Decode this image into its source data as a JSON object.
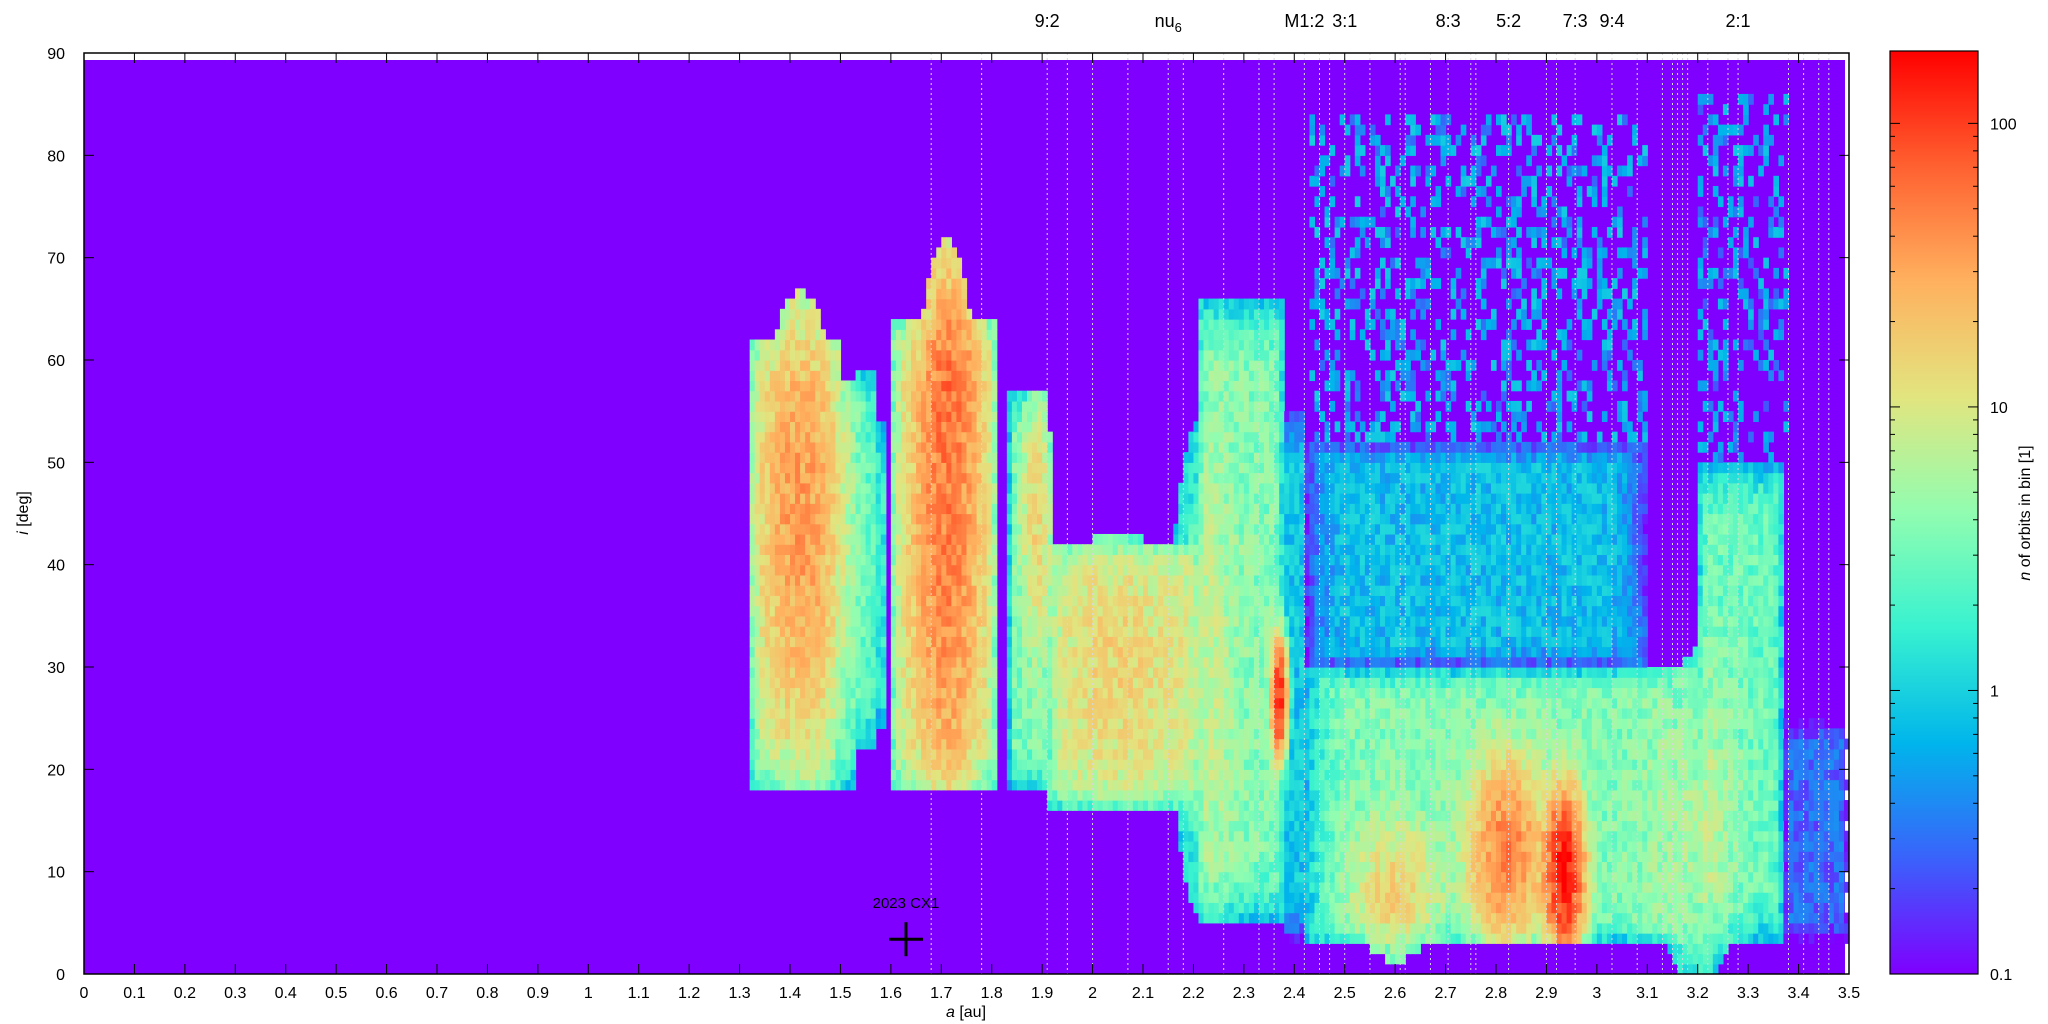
{
  "chart_data": {
    "type": "heatmap",
    "title": "",
    "xlabel_prefix": "a",
    "xlabel_suffix": " [au]",
    "ylabel_prefix": "i",
    "ylabel_suffix": " [deg]",
    "xlim": [
      0,
      3.5
    ],
    "ylim": [
      0,
      90
    ],
    "x_ticks": [
      "0",
      "0.1",
      "0.2",
      "0.3",
      "0.4",
      "0.5",
      "0.6",
      "0.7",
      "0.8",
      "0.9",
      "1",
      "1.1",
      "1.2",
      "1.3",
      "1.4",
      "1.5",
      "1.6",
      "1.7",
      "1.8",
      "1.9",
      "2",
      "2.1",
      "2.2",
      "2.3",
      "2.4",
      "2.5",
      "2.6",
      "2.7",
      "2.8",
      "2.9",
      "3",
      "3.1",
      "3.2",
      "3.3",
      "3.4",
      "3.5"
    ],
    "y_ticks": [
      "0",
      "10",
      "20",
      "30",
      "40",
      "50",
      "60",
      "70",
      "80",
      "90"
    ],
    "colorbar": {
      "label_prefix": "n",
      "label_suffix": " of orbits in bin [1]",
      "scale": "log",
      "range": [
        0.1,
        180
      ],
      "ticks": [
        "0.1",
        "1",
        "10",
        "100"
      ],
      "colormap": [
        "#7f00ff",
        "#3a62fb",
        "#00b5eb",
        "#38f2d0",
        "#91fdb0",
        "#e2e57f",
        "#ffb15f",
        "#ff6130",
        "#ff0000"
      ]
    },
    "resonances": [
      {
        "label": "9:2",
        "a": 1.91
      },
      {
        "label": "nu6",
        "a": 2.15
      },
      {
        "label": "M1:2",
        "a": 2.42
      },
      {
        "label": "3:1",
        "a": 2.5
      },
      {
        "label": "8:3",
        "a": 2.705
      },
      {
        "label": "5:2",
        "a": 2.825
      },
      {
        "label": "7:3",
        "a": 2.957
      },
      {
        "label": "9:4",
        "a": 3.03
      },
      {
        "label": "2:1",
        "a": 3.28
      }
    ],
    "marker": {
      "label": "2023 CX1",
      "a": 1.63,
      "i": 3.4
    },
    "blobs": [
      {
        "a": 1.42,
        "i": 45,
        "sa": 0.05,
        "si": 13,
        "v": 32
      },
      {
        "a": 1.71,
        "i": 45,
        "sa": 0.04,
        "si": 16,
        "v": 45
      },
      {
        "a": 1.72,
        "i": 58,
        "sa": 0.03,
        "si": 5,
        "v": 25
      },
      {
        "a": 1.89,
        "i": 45,
        "sa": 0.02,
        "si": 7,
        "v": 12
      },
      {
        "a": 2.05,
        "i": 30,
        "sa": 0.08,
        "si": 8,
        "v": 10
      },
      {
        "a": 2.37,
        "i": 27,
        "sa": 0.008,
        "si": 3,
        "v": 120
      },
      {
        "a": 2.82,
        "i": 12,
        "sa": 0.04,
        "si": 5,
        "v": 45
      },
      {
        "a": 2.935,
        "i": 10,
        "sa": 0.02,
        "si": 4,
        "v": 160
      },
      {
        "a": 2.6,
        "i": 8,
        "sa": 0.05,
        "si": 4,
        "v": 12
      },
      {
        "a": 3.2,
        "i": 15,
        "sa": 0.05,
        "si": 10,
        "v": 5
      },
      {
        "a": 2.22,
        "i": 30,
        "sa": 0.04,
        "si": 15,
        "v": 4
      }
    ],
    "regions": [
      {
        "a0": 1.325,
        "a1": 1.5,
        "i0": 18.5,
        "i1": 62,
        "level": 5
      },
      {
        "a0": 1.5,
        "a1": 1.53,
        "i0": 18.5,
        "i1": 58,
        "level": 2
      },
      {
        "a0": 1.53,
        "a1": 1.57,
        "i0": 22,
        "i1": 59,
        "level": 2
      },
      {
        "a0": 1.57,
        "a1": 1.59,
        "i0": 24,
        "i1": 54,
        "level": 1.2
      },
      {
        "a0": 1.6,
        "a1": 1.81,
        "i0": 18,
        "i1": 64,
        "level": 8
      },
      {
        "a0": 1.835,
        "a1": 1.91,
        "i0": 18,
        "i1": 57,
        "level": 3
      },
      {
        "a0": 1.91,
        "a1": 2.21,
        "i0": 16.5,
        "i1": 42,
        "level": 6
      },
      {
        "a0": 2.21,
        "a1": 2.38,
        "i0": 5,
        "i1": 66,
        "level": 4
      },
      {
        "a0": 2.38,
        "a1": 2.42,
        "i0": 3.5,
        "i1": 55,
        "level": 0.9
      },
      {
        "a0": 2.42,
        "a1": 3.2,
        "i0": 3,
        "i1": 30,
        "level": 4
      },
      {
        "a0": 2.42,
        "a1": 3.1,
        "i0": 30,
        "i1": 52,
        "level": 0.8
      },
      {
        "a0": 3.2,
        "a1": 3.37,
        "i0": 3,
        "i1": 50,
        "level": 3
      },
      {
        "a0": 3.37,
        "a1": 3.5,
        "i0": 3,
        "i1": 25,
        "level": 0.3
      }
    ],
    "sparse_regions": [
      {
        "a0": 2.43,
        "a1": 3.1,
        "i0": 50,
        "i1": 84,
        "level": 0.5
      },
      {
        "a0": 3.2,
        "a1": 3.38,
        "i0": 50,
        "i1": 86,
        "level": 0.45
      }
    ]
  }
}
